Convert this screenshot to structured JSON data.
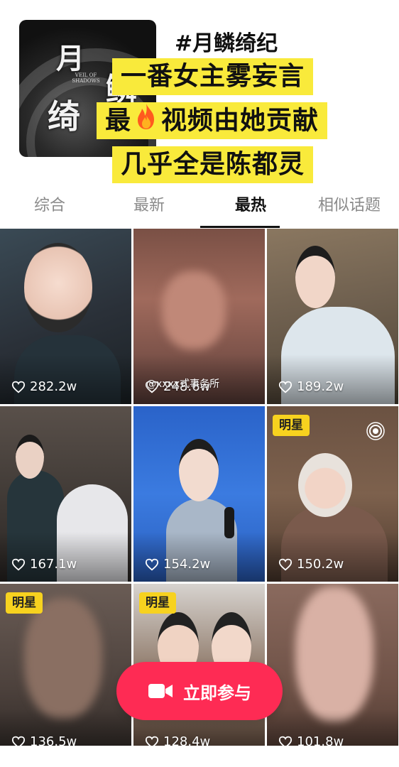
{
  "header": {
    "cover": {
      "char1": "月",
      "char2": "鳞",
      "char3": "绮",
      "subtitle": "VEIL OF SHADOWS"
    },
    "topic_title": "#月鳞绮纪",
    "highlight_lines": [
      "一番女主雾妄言",
      "最",
      "视频由她贡献",
      "几乎全是陈都灵"
    ]
  },
  "tabs": [
    {
      "label": "综合"
    },
    {
      "label": "最新"
    },
    {
      "label": "最热"
    },
    {
      "label": "相似话题"
    }
  ],
  "active_tab": "最热",
  "videos": [
    {
      "likes": "282.2w"
    },
    {
      "likes": "248.6w"
    },
    {
      "likes": "189.2w"
    },
    {
      "likes": "167.1w"
    },
    {
      "likes": "154.2w"
    },
    {
      "likes": "150.2w",
      "badge": "明星"
    },
    {
      "likes": "136.5w",
      "badge": "明星"
    },
    {
      "likes": "128.4w",
      "badge": "明星"
    },
    {
      "likes": "101.8w"
    }
  ],
  "watermark": "@xxxx式事务所",
  "join_button": {
    "label": "立即参与"
  },
  "colors": {
    "highlight": "#f9ea3b",
    "badge": "#f7d21f",
    "button": "#fe2b54"
  }
}
